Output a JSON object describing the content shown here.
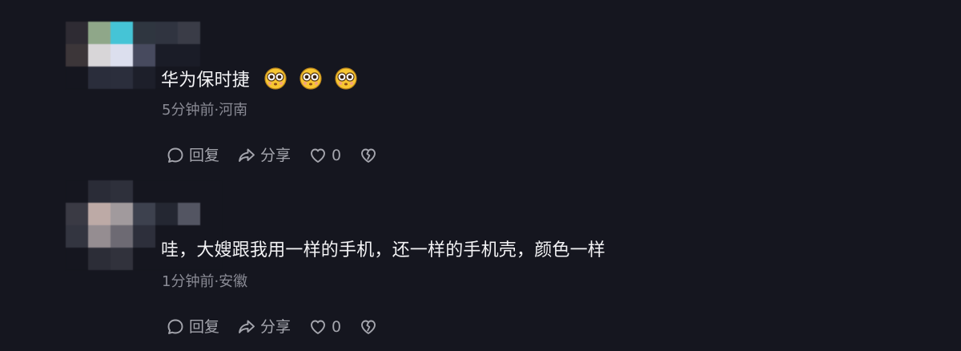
{
  "comments": [
    {
      "text": "华为保时捷",
      "emojis": [
        "eyes-face-icon",
        "eyes-face-icon",
        "eyes-face-icon"
      ],
      "meta": "5分钟前·河南",
      "actions": {
        "reply": "回复",
        "share": "分享",
        "likes": "0"
      }
    },
    {
      "text": "哇，大嫂跟我用一样的手机，还一样的手机壳，颜色一样",
      "meta": "1分钟前·安徽",
      "actions": {
        "reply": "回复",
        "share": "分享",
        "likes": "0"
      }
    }
  ],
  "colors": {
    "background": "#15161f",
    "text": "#f3f3f5",
    "meta": "#8a8b95",
    "action": "#a4a5ad"
  }
}
